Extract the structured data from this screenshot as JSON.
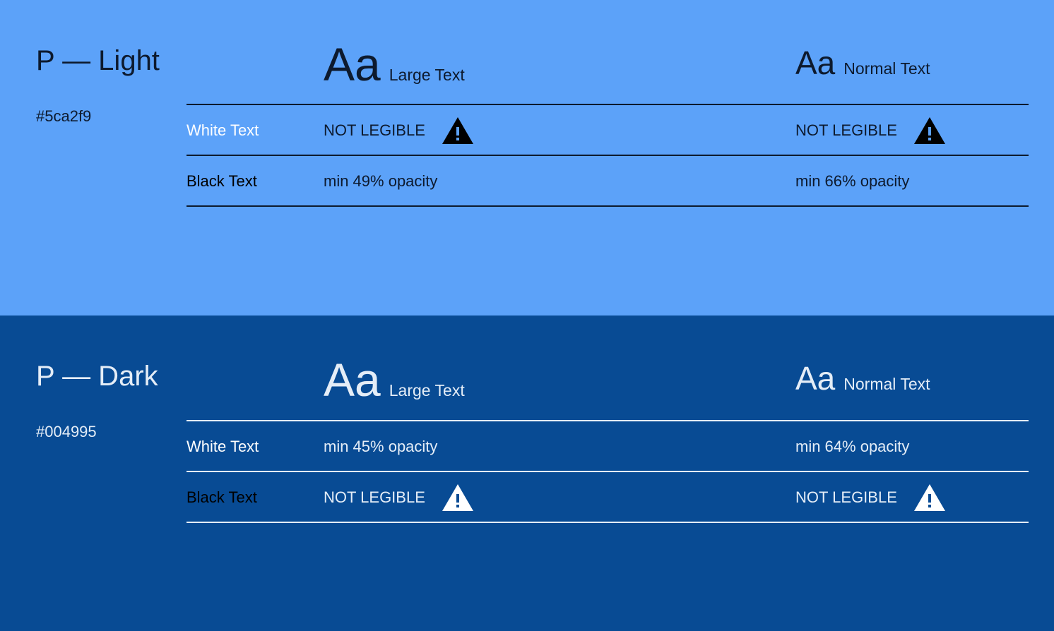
{
  "palette": {
    "light_bg": "#5ca2f9",
    "dark_bg": "#084b94",
    "light_ink": "#0d1a2e",
    "dark_ink": "#e4edf7"
  },
  "headers": {
    "aa": "Aa",
    "large_text": "Large Text",
    "normal_text": "Normal Text"
  },
  "light": {
    "title": "P — Light",
    "hex": "#5ca2f9",
    "white_row": {
      "label": "White Text",
      "large": "NOT LEGIBLE",
      "normal": "NOT LEGIBLE",
      "large_icon": "warning-icon",
      "normal_icon": "warning-icon"
    },
    "black_row": {
      "label": "Black Text",
      "large": "min 49% opacity",
      "normal": "min 66% opacity"
    }
  },
  "dark": {
    "title": "P — Dark",
    "hex": "#004995",
    "white_row": {
      "label": "White Text",
      "large": "min 45% opacity",
      "normal": "min 64% opacity"
    },
    "black_row": {
      "label": "Black Text",
      "large": "NOT LEGIBLE",
      "normal": "NOT LEGIBLE",
      "large_icon": "warning-icon",
      "normal_icon": "warning-icon"
    }
  }
}
